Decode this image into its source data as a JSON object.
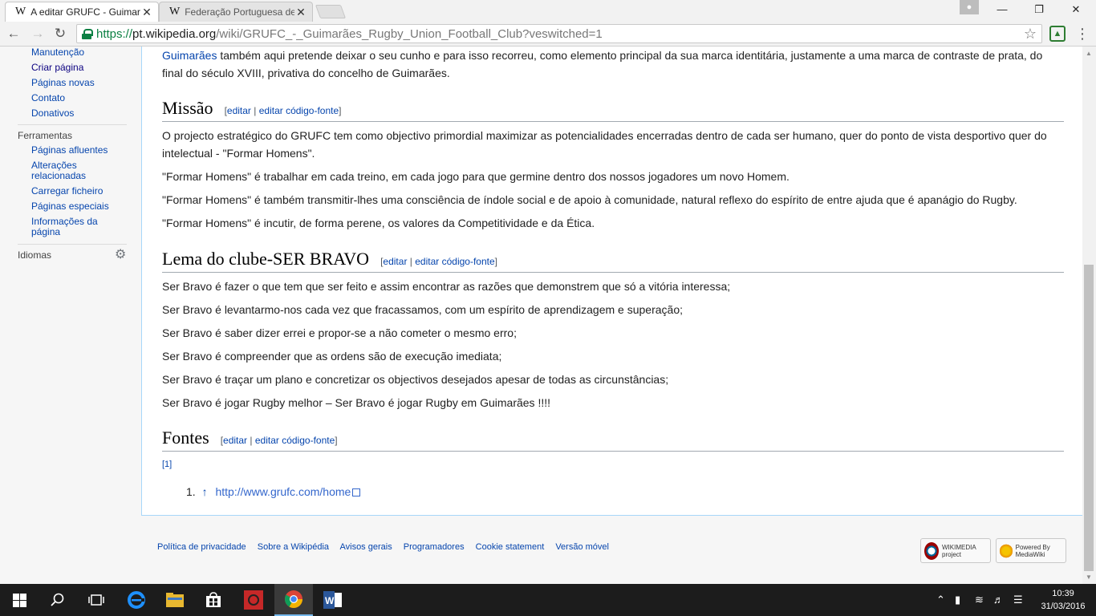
{
  "browser": {
    "tabs": [
      {
        "favicon": "W",
        "title": "A editar GRUFC - Guimarã",
        "close": "✕"
      },
      {
        "favicon": "W",
        "title": "Federação Portuguesa de",
        "close": "✕"
      }
    ],
    "url": {
      "scheme": "https://",
      "host": "pt.wikipedia.org",
      "path": "/wiki/GRUFC_-_Guimarães_Rugby_Union_Football_Club?veswitched=1"
    },
    "window_controls": {
      "minimize": "—",
      "maximize": "❐",
      "close": "✕"
    }
  },
  "sidebar": {
    "interaction_items": [
      "Manutenção",
      "Criar página",
      "Páginas novas",
      "Contato",
      "Donativos"
    ],
    "tools_heading": "Ferramentas",
    "tools_items": [
      "Páginas afluentes",
      "Alterações relacionadas",
      "Carregar ficheiro",
      "Páginas especiais",
      "Informações da página"
    ],
    "languages_heading": "Idiomas"
  },
  "article": {
    "intro_link": "Guimarães",
    "intro_text": " também aqui pretende deixar o seu cunho e para isso recorreu, como elemento principal da sua marca identitária, justamente a uma marca de contraste de prata, do final do século XVIII, privativa do concelho de Guimarães.",
    "edit_link": "editar",
    "edit_source_link": "editar código-fonte",
    "sections": [
      {
        "title": "Missão",
        "paragraphs": [
          "O projecto estratégico do GRUFC tem como objectivo primordial maximizar as potencialidades encerradas dentro de cada ser humano, quer do ponto de vista desportivo quer do intelectual - \"Formar Homens\".",
          "\"Formar Homens\" é trabalhar em cada treino, em cada jogo para que germine dentro dos nossos jogadores um novo Homem.",
          "\"Formar Homens\" é também transmitir-lhes uma consciência de índole social e de apoio à comunidade, natural reflexo do espírito de entre ajuda que é apanágio do Rugby.",
          "\"Formar Homens\" é incutir, de forma perene, os valores da Competitividade e da Ética."
        ]
      },
      {
        "title": "Lema do clube-SER BRAVO",
        "paragraphs": [
          "Ser Bravo é fazer o que tem que ser feito e assim encontrar as razões que demonstrem que só a vitória interessa;",
          "Ser Bravo é levantarmo-nos cada vez que fracassamos, com um espírito de aprendizagem e superação;",
          "Ser Bravo é saber dizer errei e propor-se a não cometer o mesmo erro;",
          "Ser Bravo é compreender que as ordens são de execução imediata;",
          "Ser Bravo é traçar um plano e concretizar os objectivos desejados apesar de todas as circunstâncias;",
          "Ser Bravo é jogar Rugby melhor – Ser Bravo é jogar Rugby em Guimarães !!!!"
        ]
      },
      {
        "title": "Fontes",
        "ref_marker": "[1]",
        "reference": {
          "number": "1.",
          "arrow": "↑",
          "link": "http://www.grufc.com/home"
        }
      }
    ]
  },
  "footer": {
    "links": [
      "Política de privacidade",
      "Sobre a Wikipédia",
      "Avisos gerais",
      "Programadores",
      "Cookie statement",
      "Versão móvel"
    ],
    "badges": [
      "WIKIMEDIA project",
      "Powered By MediaWiki"
    ]
  },
  "taskbar": {
    "time": "10:39",
    "date": "31/03/2016"
  }
}
